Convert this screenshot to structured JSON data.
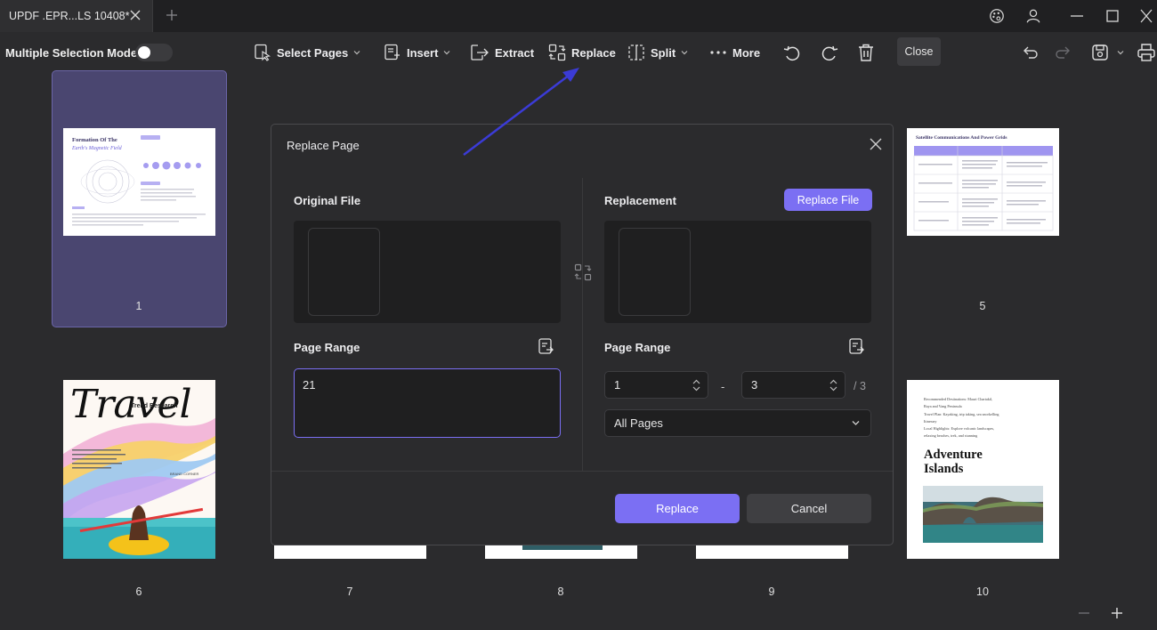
{
  "app": {
    "tab_title": "UPDF .EPR...LS 10408*"
  },
  "toolbar": {
    "multi_select_label": "Multiple Selection Mode",
    "select_pages": "Select Pages",
    "insert": "Insert",
    "extract": "Extract",
    "replace": "Replace",
    "split": "Split",
    "more": "More",
    "close": "Close"
  },
  "pages": {
    "numbers": [
      "1",
      "5",
      "6",
      "7",
      "8",
      "9",
      "10"
    ],
    "p1": {
      "title_line1": "Formation Of The",
      "title_line2": "Earth's Magnetic Field"
    },
    "p5": {
      "title": "Satellite Communications And Power Grids"
    },
    "p6": {
      "script_title": "Travel",
      "subtitle": "Trend Research",
      "tag": "BRAND CORNER"
    },
    "p10": {
      "lines": [
        "Recommended Destinations: Mauri Chartakil,",
        "Raya and Vang Peninsula",
        "Travel Plan: Kayaking, trip taking, sea snorkelling",
        "Itinerary",
        "Local Highlights: Explore volcanic landscapes,",
        "relaxing beaches, trek, and stunning"
      ],
      "title_line1": "Adventure",
      "title_line2": "Islands"
    }
  },
  "dialog": {
    "title": "Replace Page",
    "original_label": "Original File",
    "replacement_label": "Replacement",
    "replace_file_button": "Replace File",
    "page_range_label": "Page Range",
    "original_range_value": "21",
    "range_from": "1",
    "range_to": "3",
    "range_total": "/ 3",
    "range_dash": "-",
    "pages_select": "All Pages",
    "replace_button": "Replace",
    "cancel_button": "Cancel"
  },
  "colors": {
    "accent": "#7b6ff3",
    "selected_page_bg": "#4a4670",
    "annotation_arrow": "#3b3bd6"
  }
}
